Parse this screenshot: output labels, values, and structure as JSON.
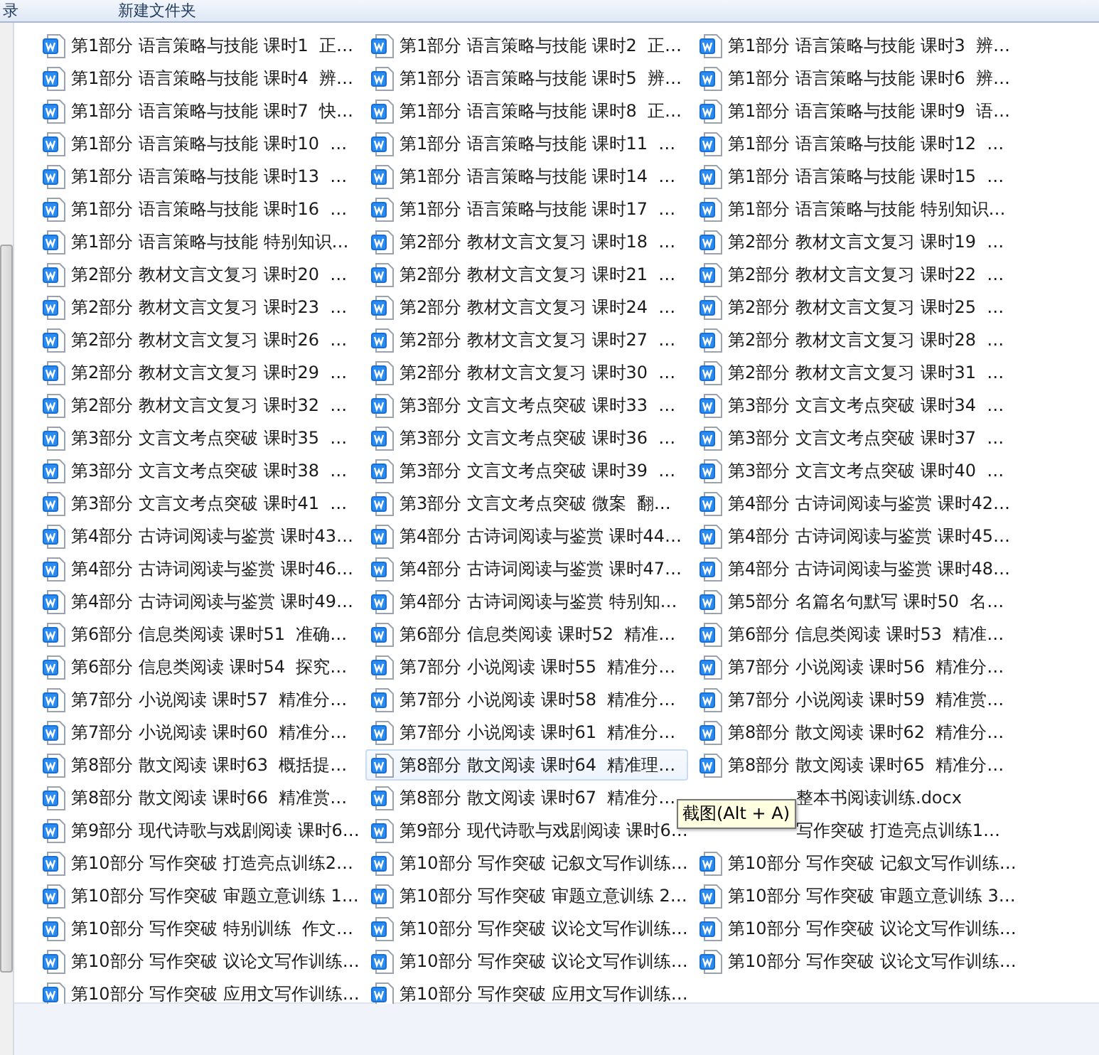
{
  "toolbar": {
    "items": [
      "录",
      "新建文件夹"
    ]
  },
  "files": [
    {
      "name": "第1部分 语言策略与技能 课时1  正…",
      "highlighted": false,
      "covered": false
    },
    {
      "name": "第1部分 语言策略与技能 课时2  正…",
      "highlighted": false,
      "covered": false
    },
    {
      "name": "第1部分 语言策略与技能 课时3  辨…",
      "highlighted": false,
      "covered": false
    },
    {
      "name": "第1部分 语言策略与技能 课时4  辨…",
      "highlighted": false,
      "covered": false
    },
    {
      "name": "第1部分 语言策略与技能 课时5  辨…",
      "highlighted": false,
      "covered": false
    },
    {
      "name": "第1部分 语言策略与技能 课时6  辨…",
      "highlighted": false,
      "covered": false
    },
    {
      "name": "第1部分 语言策略与技能 课时7  快…",
      "highlighted": false,
      "covered": false
    },
    {
      "name": "第1部分 语言策略与技能 课时8  正…",
      "highlighted": false,
      "covered": false
    },
    {
      "name": "第1部分 语言策略与技能 课时9  语…",
      "highlighted": false,
      "covered": false
    },
    {
      "name": "第1部分 语言策略与技能 课时10  …",
      "highlighted": false,
      "covered": false
    },
    {
      "name": "第1部分 语言策略与技能 课时11  …",
      "highlighted": false,
      "covered": false
    },
    {
      "name": "第1部分 语言策略与技能 课时12  …",
      "highlighted": false,
      "covered": false
    },
    {
      "name": "第1部分 语言策略与技能 课时13  …",
      "highlighted": false,
      "covered": false
    },
    {
      "name": "第1部分 语言策略与技能 课时14  …",
      "highlighted": false,
      "covered": false
    },
    {
      "name": "第1部分 语言策略与技能 课时15  …",
      "highlighted": false,
      "covered": false
    },
    {
      "name": "第1部分 语言策略与技能 课时16  …",
      "highlighted": false,
      "covered": false
    },
    {
      "name": "第1部分 语言策略与技能 课时17  …",
      "highlighted": false,
      "covered": false
    },
    {
      "name": "第1部分 语言策略与技能 特别知识…",
      "highlighted": false,
      "covered": false
    },
    {
      "name": "第1部分 语言策略与技能 特别知识…",
      "highlighted": false,
      "covered": false
    },
    {
      "name": "第2部分 教材文言文复习 课时18  …",
      "highlighted": false,
      "covered": false
    },
    {
      "name": "第2部分 教材文言文复习 课时19  …",
      "highlighted": false,
      "covered": false
    },
    {
      "name": "第2部分 教材文言文复习 课时20  …",
      "highlighted": false,
      "covered": false
    },
    {
      "name": "第2部分 教材文言文复习 课时21  …",
      "highlighted": false,
      "covered": false
    },
    {
      "name": "第2部分 教材文言文复习 课时22  …",
      "highlighted": false,
      "covered": false
    },
    {
      "name": "第2部分 教材文言文复习 课时23  …",
      "highlighted": false,
      "covered": false
    },
    {
      "name": "第2部分 教材文言文复习 课时24  …",
      "highlighted": false,
      "covered": false
    },
    {
      "name": "第2部分 教材文言文复习 课时25  …",
      "highlighted": false,
      "covered": false
    },
    {
      "name": "第2部分 教材文言文复习 课时26  …",
      "highlighted": false,
      "covered": false
    },
    {
      "name": "第2部分 教材文言文复习 课时27  …",
      "highlighted": false,
      "covered": false
    },
    {
      "name": "第2部分 教材文言文复习 课时28  …",
      "highlighted": false,
      "covered": false
    },
    {
      "name": "第2部分 教材文言文复习 课时29  …",
      "highlighted": false,
      "covered": false
    },
    {
      "name": "第2部分 教材文言文复习 课时30  …",
      "highlighted": false,
      "covered": false
    },
    {
      "name": "第2部分 教材文言文复习 课时31  …",
      "highlighted": false,
      "covered": false
    },
    {
      "name": "第2部分 教材文言文复习 课时32  …",
      "highlighted": false,
      "covered": false
    },
    {
      "name": "第3部分 文言文考点突破 课时33  …",
      "highlighted": false,
      "covered": false
    },
    {
      "name": "第3部分 文言文考点突破 课时34  …",
      "highlighted": false,
      "covered": false
    },
    {
      "name": "第3部分 文言文考点突破 课时35  …",
      "highlighted": false,
      "covered": false
    },
    {
      "name": "第3部分 文言文考点突破 课时36  …",
      "highlighted": false,
      "covered": false
    },
    {
      "name": "第3部分 文言文考点突破 课时37  …",
      "highlighted": false,
      "covered": false
    },
    {
      "name": "第3部分 文言文考点突破 课时38  …",
      "highlighted": false,
      "covered": false
    },
    {
      "name": "第3部分 文言文考点突破 课时39  …",
      "highlighted": false,
      "covered": false
    },
    {
      "name": "第3部分 文言文考点突破 课时40  …",
      "highlighted": false,
      "covered": false
    },
    {
      "name": "第3部分 文言文考点突破 课时41  …",
      "highlighted": false,
      "covered": false
    },
    {
      "name": "第3部分 文言文考点突破 微案  翻…",
      "highlighted": false,
      "covered": false
    },
    {
      "name": "第4部分 古诗词阅读与鉴赏 课时42…",
      "highlighted": false,
      "covered": false
    },
    {
      "name": "第4部分 古诗词阅读与鉴赏 课时43…",
      "highlighted": false,
      "covered": false
    },
    {
      "name": "第4部分 古诗词阅读与鉴赏 课时44…",
      "highlighted": false,
      "covered": false
    },
    {
      "name": "第4部分 古诗词阅读与鉴赏 课时45…",
      "highlighted": false,
      "covered": false
    },
    {
      "name": "第4部分 古诗词阅读与鉴赏 课时46…",
      "highlighted": false,
      "covered": false
    },
    {
      "name": "第4部分 古诗词阅读与鉴赏 课时47…",
      "highlighted": false,
      "covered": false
    },
    {
      "name": "第4部分 古诗词阅读与鉴赏 课时48…",
      "highlighted": false,
      "covered": false
    },
    {
      "name": "第4部分 古诗词阅读与鉴赏 课时49…",
      "highlighted": false,
      "covered": false
    },
    {
      "name": "第4部分 古诗词阅读与鉴赏 特别知…",
      "highlighted": false,
      "covered": false
    },
    {
      "name": "第5部分 名篇名句默写 课时50  名…",
      "highlighted": false,
      "covered": false
    },
    {
      "name": "第6部分 信息类阅读 课时51  准确…",
      "highlighted": false,
      "covered": false
    },
    {
      "name": "第6部分 信息类阅读 课时52  精准…",
      "highlighted": false,
      "covered": false
    },
    {
      "name": "第6部分 信息类阅读 课时53  精准…",
      "highlighted": false,
      "covered": false
    },
    {
      "name": "第6部分 信息类阅读 课时54  探究…",
      "highlighted": false,
      "covered": false
    },
    {
      "name": "第7部分 小说阅读 课时55  精准分…",
      "highlighted": false,
      "covered": false
    },
    {
      "name": "第7部分 小说阅读 课时56  精准分…",
      "highlighted": false,
      "covered": false
    },
    {
      "name": "第7部分 小说阅读 课时57  精准分…",
      "highlighted": false,
      "covered": false
    },
    {
      "name": "第7部分 小说阅读 课时58  精准分…",
      "highlighted": false,
      "covered": false
    },
    {
      "name": "第7部分 小说阅读 课时59  精准赏…",
      "highlighted": false,
      "covered": false
    },
    {
      "name": "第7部分 小说阅读 课时60  精准分…",
      "highlighted": false,
      "covered": false
    },
    {
      "name": "第7部分 小说阅读 课时61  精准分…",
      "highlighted": false,
      "covered": false
    },
    {
      "name": "第8部分 散文阅读 课时62  精准分…",
      "highlighted": false,
      "covered": false
    },
    {
      "name": "第8部分 散文阅读 课时63  概括提…",
      "highlighted": false,
      "covered": false
    },
    {
      "name": "第8部分 散文阅读 课时64  精准理…",
      "highlighted": true,
      "covered": false
    },
    {
      "name": "第8部分 散文阅读 课时65  精准分…",
      "highlighted": false,
      "covered": false
    },
    {
      "name": "第8部分 散文阅读 课时66  精准赏…",
      "highlighted": false,
      "covered": false
    },
    {
      "name": "第8部分 散文阅读 课时67  精准分…",
      "highlighted": false,
      "covered": false
    },
    {
      "name": "整本书阅读训练.docx",
      "highlighted": false,
      "covered": true
    },
    {
      "name": "第9部分 现代诗歌与戏剧阅读 课时6…",
      "highlighted": false,
      "covered": false
    },
    {
      "name": "第9部分 现代诗歌与戏剧阅读 课时6…",
      "highlighted": false,
      "covered": false
    },
    {
      "name": "写作突破 打造亮点训练1…",
      "highlighted": false,
      "covered": true
    },
    {
      "name": "第10部分 写作突破 打造亮点训练2…",
      "highlighted": false,
      "covered": false
    },
    {
      "name": "第10部分 写作突破 记叙文写作训练…",
      "highlighted": false,
      "covered": false
    },
    {
      "name": "第10部分 写作突破 记叙文写作训练…",
      "highlighted": false,
      "covered": false
    },
    {
      "name": "第10部分 写作突破 审题立意训练 1…",
      "highlighted": false,
      "covered": false
    },
    {
      "name": "第10部分 写作突破 审题立意训练 2…",
      "highlighted": false,
      "covered": false
    },
    {
      "name": "第10部分 写作突破 审题立意训练 3…",
      "highlighted": false,
      "covered": false
    },
    {
      "name": "第10部分 写作突破 特别训练  作文…",
      "highlighted": false,
      "covered": false
    },
    {
      "name": "第10部分 写作突破 议论文写作训练…",
      "highlighted": false,
      "covered": false
    },
    {
      "name": "第10部分 写作突破 议论文写作训练…",
      "highlighted": false,
      "covered": false
    },
    {
      "name": "第10部分 写作突破 议论文写作训练…",
      "highlighted": false,
      "covered": false
    },
    {
      "name": "第10部分 写作突破 议论文写作训练…",
      "highlighted": false,
      "covered": false
    },
    {
      "name": "第10部分 写作突破 议论文写作训练…",
      "highlighted": false,
      "covered": false
    },
    {
      "name": "第10部分 写作突破 应用文写作训练…",
      "highlighted": false,
      "covered": false
    },
    {
      "name": "第10部分 写作突破 应用文写作训练…",
      "highlighted": false,
      "covered": false
    }
  ],
  "tooltip": {
    "text": "截图(Alt + A)"
  }
}
